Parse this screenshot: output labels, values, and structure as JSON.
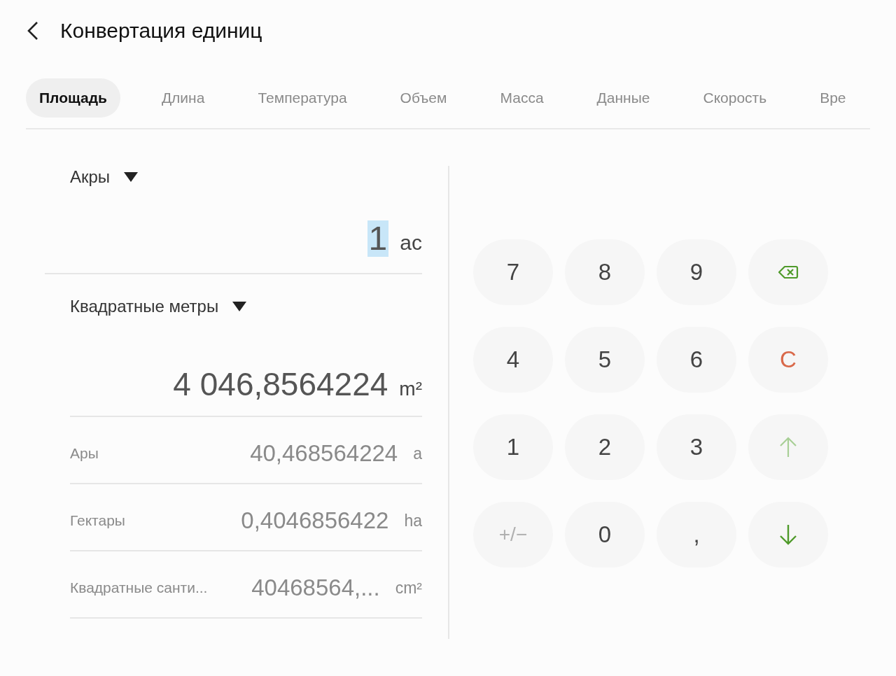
{
  "header": {
    "title": "Конвертация единиц"
  },
  "tabs": [
    {
      "label": "Площадь",
      "selected": true
    },
    {
      "label": "Длина",
      "selected": false
    },
    {
      "label": "Температура",
      "selected": false
    },
    {
      "label": "Объем",
      "selected": false
    },
    {
      "label": "Масса",
      "selected": false
    },
    {
      "label": "Данные",
      "selected": false
    },
    {
      "label": "Скорость",
      "selected": false
    },
    {
      "label": "Вре",
      "selected": false
    }
  ],
  "source": {
    "unit_name": "Акры",
    "value": "1",
    "value_selected": true,
    "unit": "ac"
  },
  "target": {
    "unit_name": "Квадратные метры",
    "value": "4 046,8564224",
    "unit": "m²"
  },
  "other_units": [
    {
      "name": "Ары",
      "value": "40,468564224",
      "unit": "a"
    },
    {
      "name": "Гектары",
      "value": "0,4046856422",
      "unit": "ha"
    },
    {
      "name": "Квадратные санти...",
      "value": "40468564,...",
      "unit": "cm²"
    }
  ],
  "keypad": [
    {
      "kind": "digit",
      "label": "7",
      "disabled": false
    },
    {
      "kind": "digit",
      "label": "8",
      "disabled": false
    },
    {
      "kind": "digit",
      "label": "9",
      "disabled": false
    },
    {
      "kind": "backspace",
      "disabled": false
    },
    {
      "kind": "digit",
      "label": "4",
      "disabled": false
    },
    {
      "kind": "digit",
      "label": "5",
      "disabled": false
    },
    {
      "kind": "digit",
      "label": "6",
      "disabled": false
    },
    {
      "kind": "clear",
      "label": "C",
      "disabled": false
    },
    {
      "kind": "digit",
      "label": "1",
      "disabled": false
    },
    {
      "kind": "digit",
      "label": "2",
      "disabled": false
    },
    {
      "kind": "digit",
      "label": "3",
      "disabled": false
    },
    {
      "kind": "up",
      "disabled": true
    },
    {
      "kind": "sign",
      "label": "+/−",
      "disabled": true
    },
    {
      "kind": "digit",
      "label": "0",
      "disabled": false
    },
    {
      "kind": "digit",
      "label": ",",
      "disabled": false
    },
    {
      "kind": "down",
      "disabled": false
    }
  ]
}
